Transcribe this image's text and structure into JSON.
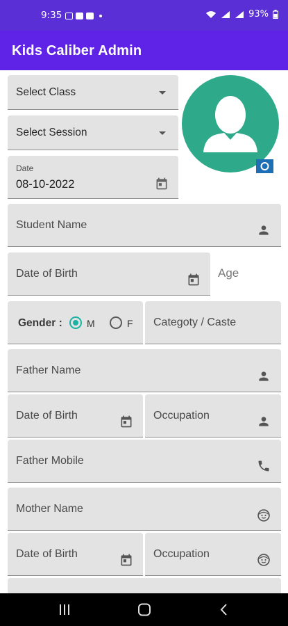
{
  "status": {
    "time": "9:35",
    "battery": "93%"
  },
  "appbar": {
    "title": "Kids Caliber Admin"
  },
  "form": {
    "select_class": "Select Class",
    "select_session": "Select Session",
    "date_label": "Date",
    "date_value": "08-10-2022",
    "student_name": "Student Name",
    "date_of_birth": "Date of Birth",
    "age": "Age",
    "gender_label": "Gender :",
    "gender_m": "M",
    "gender_f": "F",
    "category": "Categoty / Caste",
    "father_name": "Father Name",
    "father_dob": "Date of Birth",
    "father_occupation": "Occupation",
    "father_mobile": "Father Mobile",
    "mother_name": "Mother Name",
    "mother_dob": "Date of Birth",
    "mother_occupation": "Occupation"
  },
  "colors": {
    "statusbar": "#5a2fd6",
    "appbar": "#5f22e7",
    "avatar": "#2eaa8a",
    "radio_selected": "#1ab2a2",
    "camera_badge": "#1f6fb5"
  },
  "icons": [
    "wifi-icon",
    "signal-icon",
    "battery-icon",
    "dropdown-caret-icon",
    "calendar-icon",
    "person-icon",
    "phone-icon",
    "face-icon",
    "camera-icon",
    "recents-icon",
    "home-icon",
    "back-icon"
  ]
}
